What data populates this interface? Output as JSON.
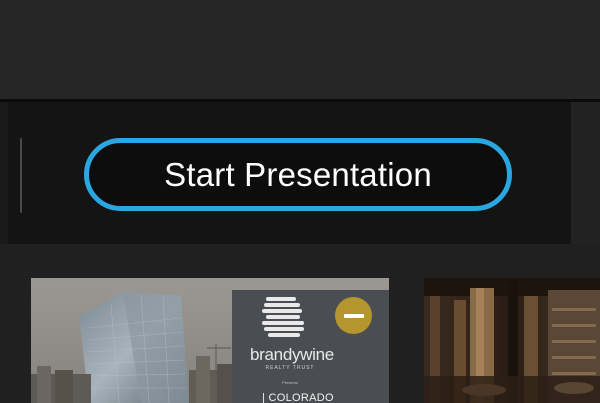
{
  "toolbar": {
    "start_presentation_label": "Start Presentation"
  },
  "cards": [
    {
      "poster_brand": "brandywine",
      "poster_subtitle": "REALTY TRUST",
      "poster_presents": "Presents",
      "poster_sign": "| COLORADO",
      "badge_icon": "minus-icon"
    },
    {}
  ],
  "colors": {
    "accent": "#2aa7e0",
    "badge": "#b5952d",
    "toolbar_bg": "#141414",
    "header_bg": "#262626"
  }
}
